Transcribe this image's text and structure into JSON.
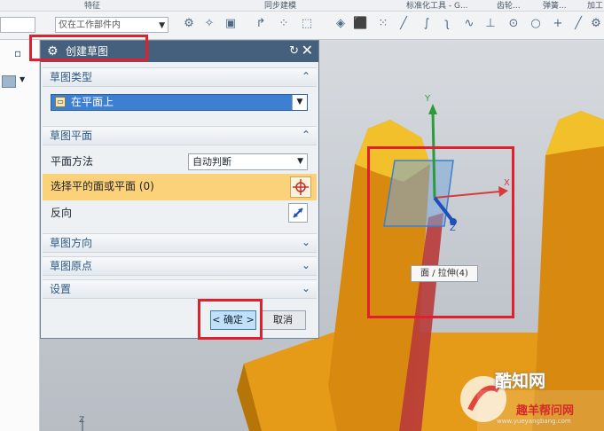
{
  "ribbon": {
    "groups": [
      "特征",
      "同步建模",
      "标准化工具 - G...",
      "齿轮...",
      "弹簧...",
      "加工"
    ],
    "filter": "仅在工作部件内"
  },
  "dialog": {
    "title": "创建草图",
    "sections": {
      "sketch_type": {
        "label": "草图类型",
        "value": "在平面上"
      },
      "sketch_plane": {
        "label": "草图平面",
        "method_label": "平面方法",
        "method_value": "自动判断",
        "select_label": "选择平的面或平面 (0)",
        "reverse_label": "反向"
      },
      "sketch_orientation": {
        "label": "草图方向"
      },
      "sketch_origin": {
        "label": "草图原点"
      },
      "settings": {
        "label": "设置"
      }
    },
    "ok_label": "< 确定 >",
    "cancel_label": "取消"
  },
  "viewport": {
    "axes": {
      "x": "X",
      "y": "Y",
      "z": "Z"
    },
    "tooltip": "面 / 拉伸(4)",
    "corner_axis": "Z"
  },
  "watermark": {
    "name": "酷知网",
    "site": "趣羊帮问网",
    "url": "www.yueyangbang.com"
  },
  "colors": {
    "title_bar": "#44607d",
    "section_header": "#2e5a86",
    "selection_row": "#fbd27a",
    "highlight": "#3d7fd0",
    "annotation_red": "#e0202c",
    "part_orange": "#e8a21c"
  }
}
